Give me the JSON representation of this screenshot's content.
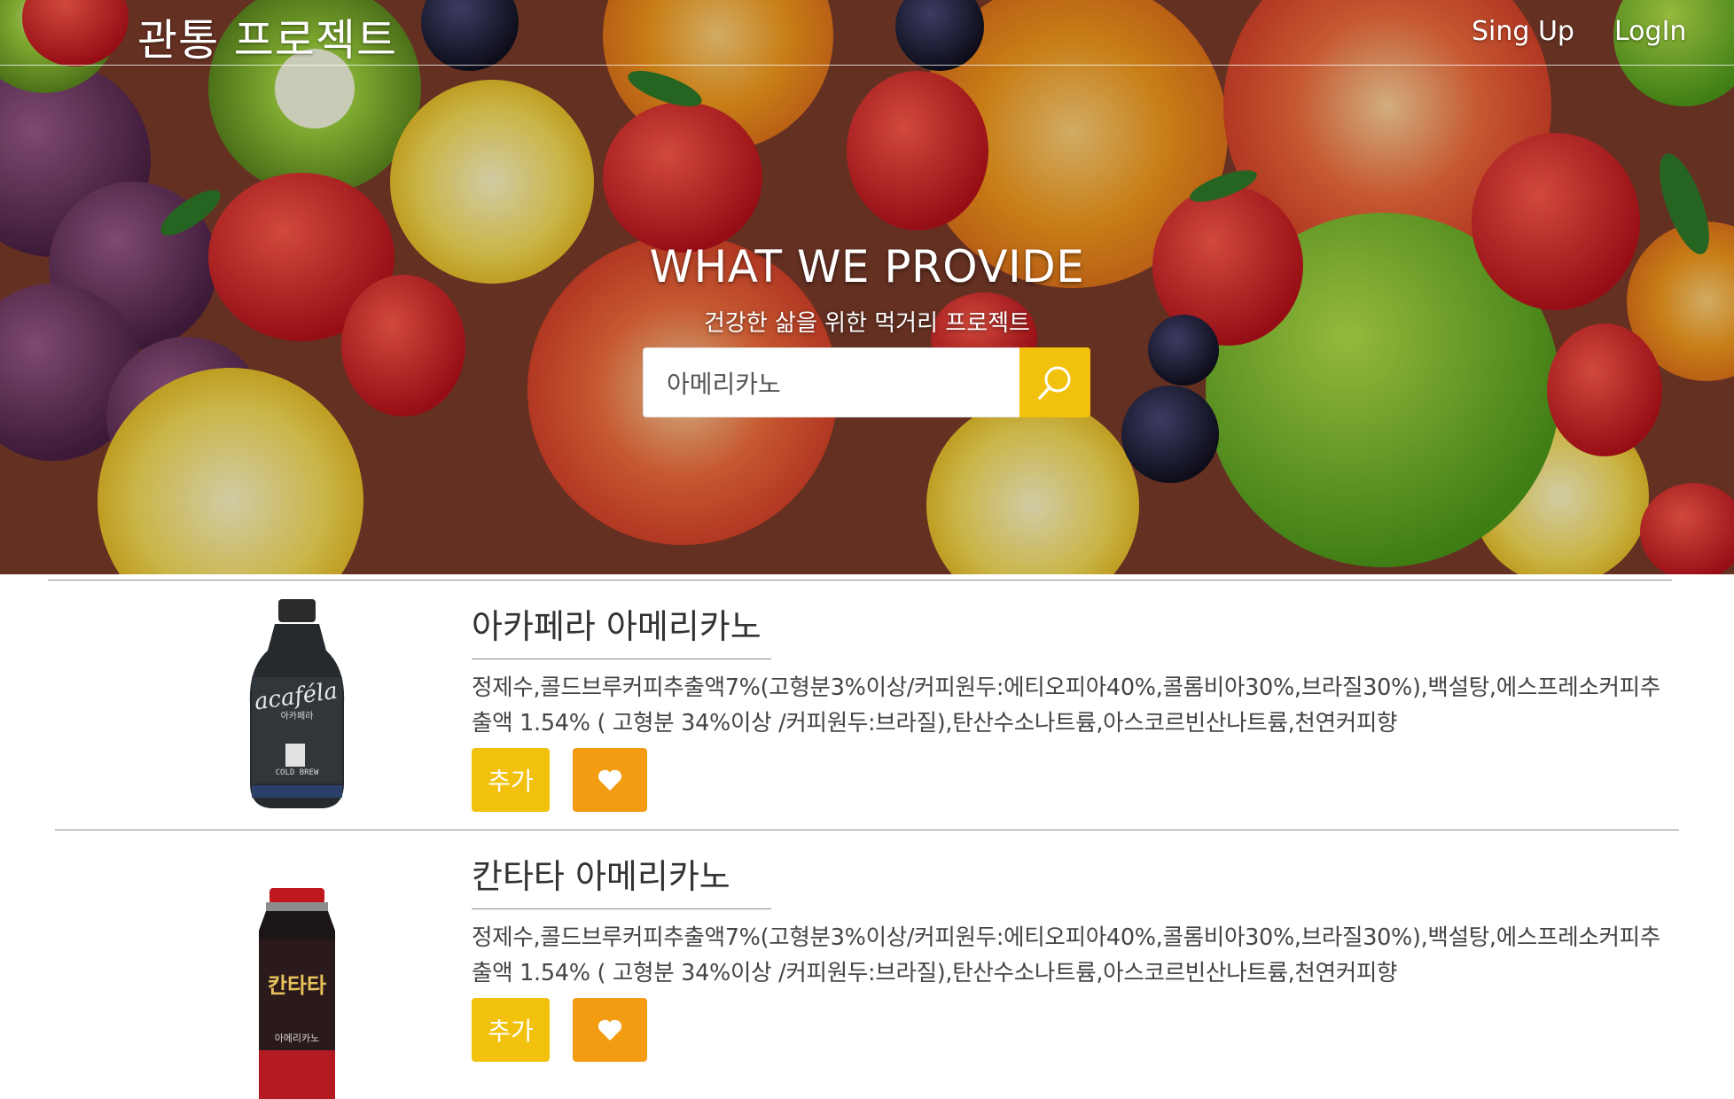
{
  "header": {
    "brand": "관통 프로젝트",
    "nav": {
      "signup": "Sing Up",
      "login": "LogIn"
    }
  },
  "hero": {
    "title": "WHAT WE PROVIDE",
    "subtitle": "건강한 삶을 위한 먹거리 프로젝트",
    "search": {
      "value": "아메리카노",
      "icon": "search-icon"
    },
    "background": "fruit-photo"
  },
  "products": [
    {
      "name": "아카페라 아메리카노",
      "description": "정제수,콜드브루커피추출액7%(고형분3%이상/커피원두:에티오피아40%,콜롬비아30%,브라질30%),백설탕,에스프레소커피추출액 1.54% ( 고형분 34%이상 /커피원두:브라질),탄산수소나트륨,아스코르빈산나트륨,천연커피향",
      "add_label": "추가",
      "like_icon": "heart-icon",
      "bottle_label": "acaféla",
      "bottle_sub": "아카페라",
      "bottle_caption": "COLD BREW"
    },
    {
      "name": "칸타타 아메리카노",
      "description": "정제수,콜드브루커피추출액7%(고형분3%이상/커피원두:에티오피아40%,콜롬비아30%,브라질30%),백설탕,에스프레소커피추출액 1.54% ( 고형분 34%이상 /커피원두:브라질),탄산수소나트륨,아스코르빈산나트륨,천연커피향",
      "add_label": "추가",
      "like_icon": "heart-icon",
      "bottle_label": "칸타타",
      "bottle_sub": "아메리카노"
    }
  ],
  "colors": {
    "accent_yellow": "#f2c10d",
    "accent_orange": "#f39c12",
    "divider": "#8a8a8a"
  }
}
